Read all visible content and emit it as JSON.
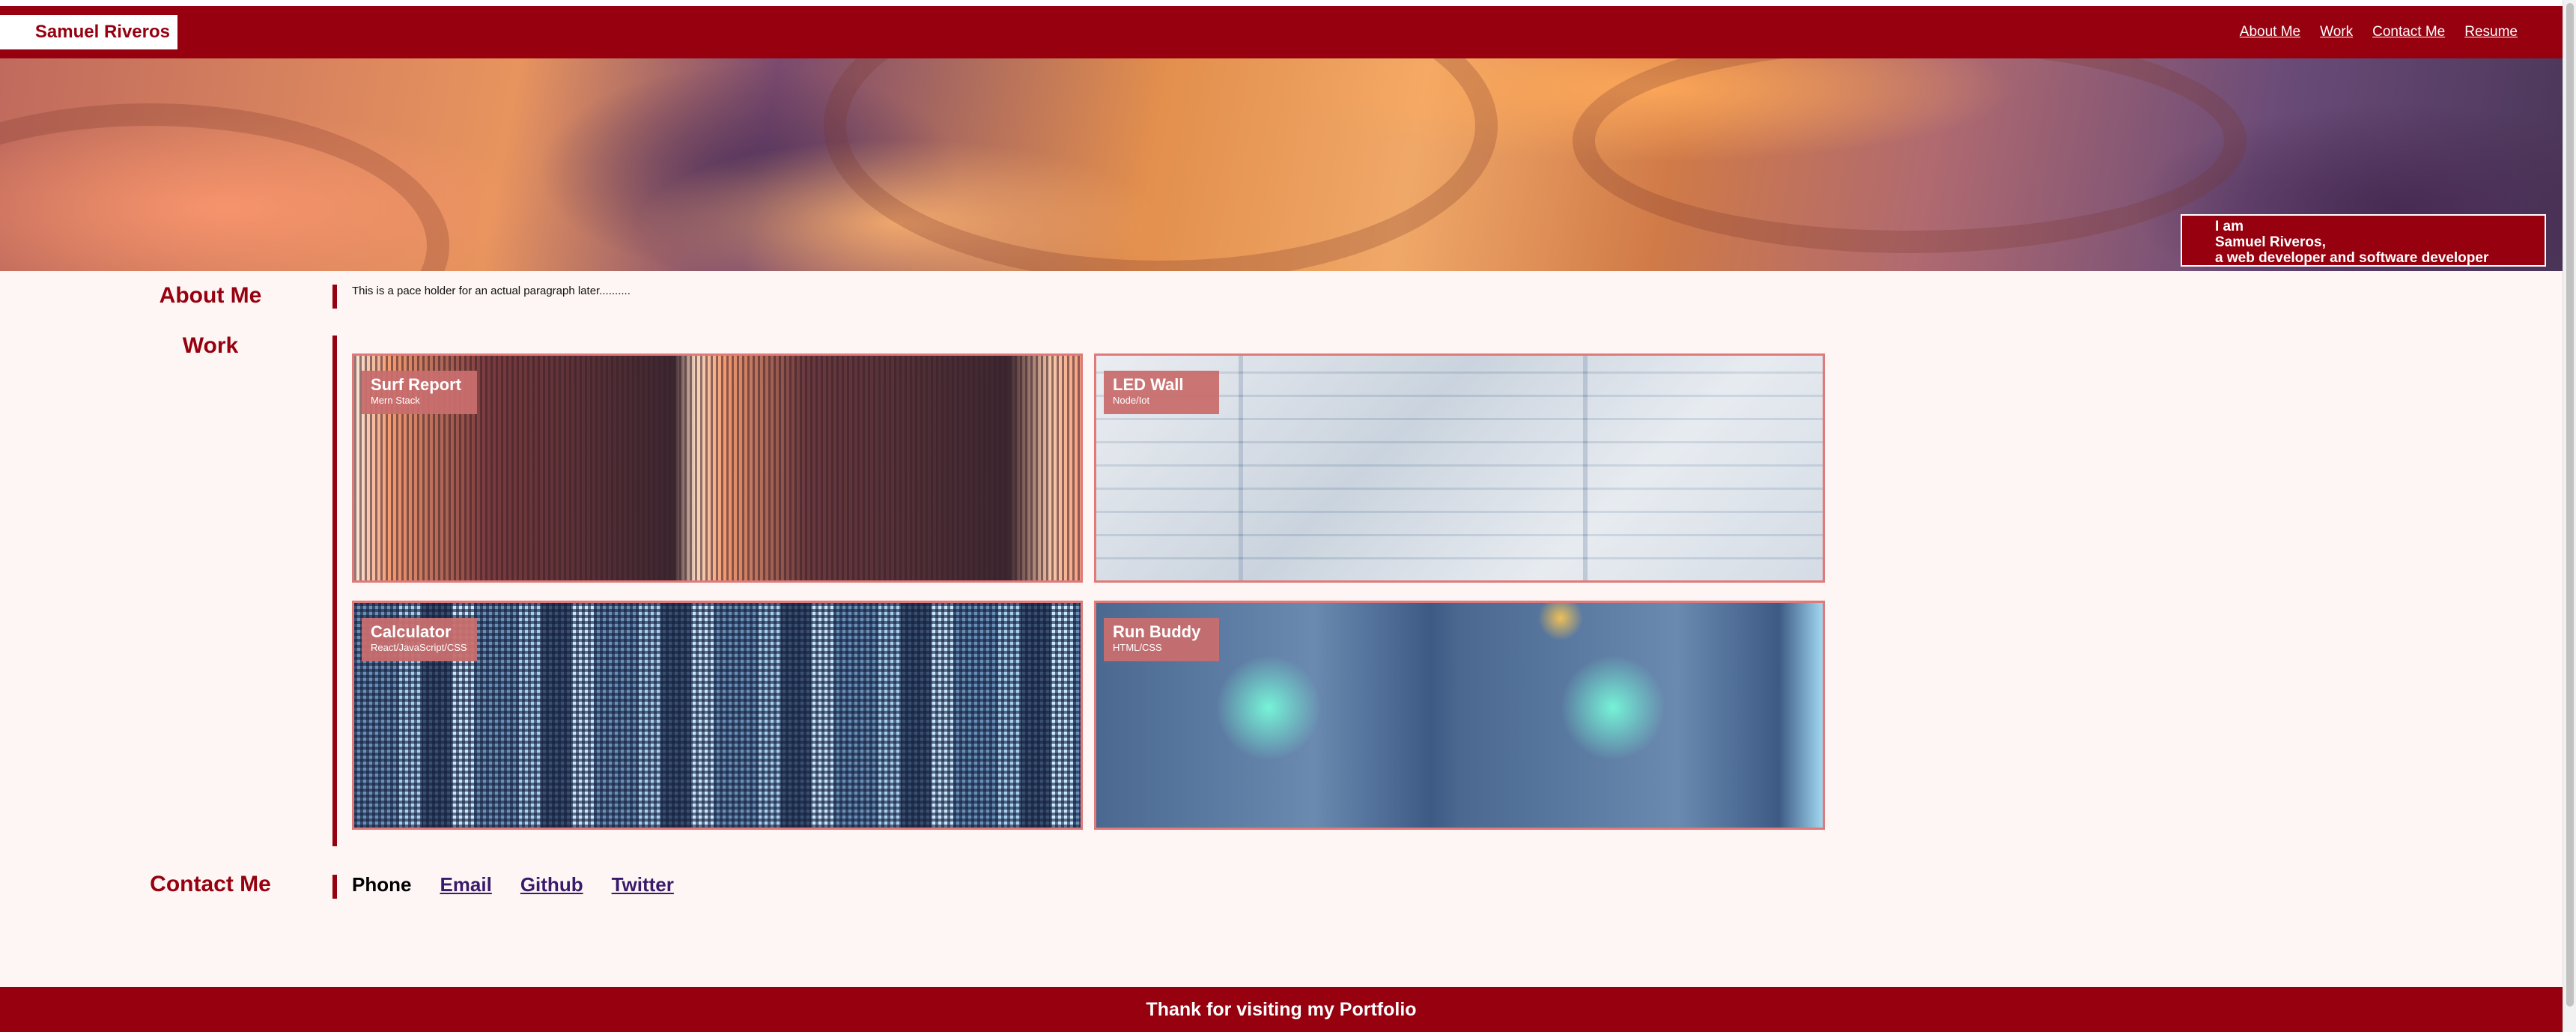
{
  "header": {
    "brand": "Samuel Riveros",
    "nav": [
      "About Me",
      "Work",
      "Contact Me",
      "Resume"
    ]
  },
  "hero": {
    "tag_line1": "I am",
    "tag_line2": "Samuel Riveros,",
    "tag_line3": "a web developer and software developer"
  },
  "sections": {
    "about_title": "About Me",
    "about_text": "This is a pace holder for an actual paragraph later..........",
    "work_title": "Work",
    "contact_title": "Contact Me"
  },
  "projects": [
    {
      "title": "Surf Report",
      "stack": "Mern Stack"
    },
    {
      "title": "LED Wall",
      "stack": "Node/Iot"
    },
    {
      "title": "Calculator",
      "stack": "React/JavaScript/CSS"
    },
    {
      "title": "Run Buddy",
      "stack": "HTML/CSS"
    }
  ],
  "contact": {
    "phone": "Phone",
    "email": "Email",
    "github": "Github",
    "twitter": "Twitter"
  },
  "footer": {
    "text": "Thank for visiting my Portfolio"
  },
  "colors": {
    "brand": "#96000f",
    "background": "#fdf6f4",
    "card_border": "#e07a7a",
    "link": "#3a1a6a"
  }
}
